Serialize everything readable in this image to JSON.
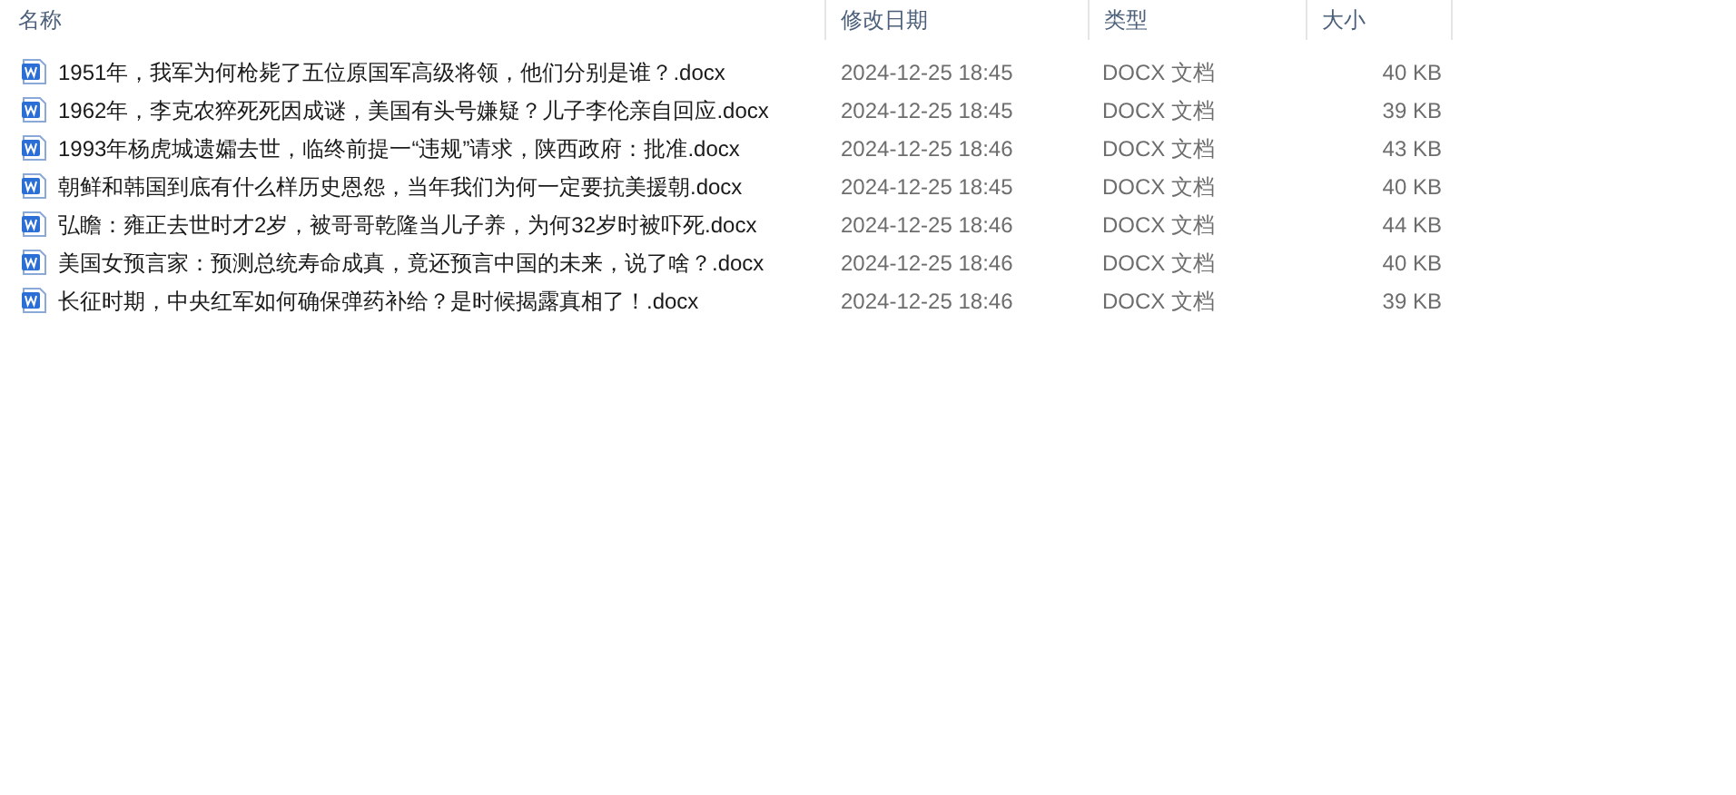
{
  "columns": [
    "名称",
    "修改日期",
    "类型",
    "大小"
  ],
  "files": [
    {
      "name": "1951年，我军为何枪毙了五位原国军高级将领，他们分别是谁？.docx",
      "modified": "2024-12-25 18:45",
      "type": "DOCX 文档",
      "size": "40 KB"
    },
    {
      "name": "1962年，李克农猝死死因成谜，美国有头号嫌疑？儿子李伦亲自回应.docx",
      "modified": "2024-12-25 18:45",
      "type": "DOCX 文档",
      "size": "39 KB"
    },
    {
      "name": "1993年杨虎城遗孀去世，临终前提一“违规”请求，陕西政府：批准.docx",
      "modified": "2024-12-25 18:46",
      "type": "DOCX 文档",
      "size": "43 KB"
    },
    {
      "name": "朝鲜和韩国到底有什么样历史恩怨，当年我们为何一定要抗美援朝.docx",
      "modified": "2024-12-25 18:45",
      "type": "DOCX 文档",
      "size": "40 KB"
    },
    {
      "name": "弘瞻：雍正去世时才2岁，被哥哥乾隆当儿子养，为何32岁时被吓死.docx",
      "modified": "2024-12-25 18:46",
      "type": "DOCX 文档",
      "size": "44 KB"
    },
    {
      "name": "美国女预言家：预测总统寿命成真，竟还预言中国的未来，说了啥？.docx",
      "modified": "2024-12-25 18:46",
      "type": "DOCX 文档",
      "size": "40 KB"
    },
    {
      "name": "长征时期，中央红军如何确保弹药补给？是时候揭露真相了！.docx",
      "modified": "2024-12-25 18:46",
      "type": "DOCX 文档",
      "size": "39 KB"
    }
  ]
}
